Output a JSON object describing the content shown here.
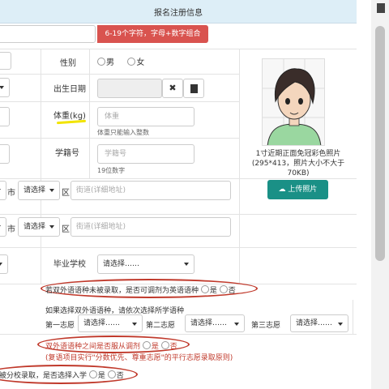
{
  "header": {
    "title": "报名注册信息"
  },
  "username_hint": "6-19个字符，字母+数字组合",
  "gender": {
    "label": "性别",
    "options": [
      "男",
      "女"
    ]
  },
  "birthdate": {
    "label": "出生日期"
  },
  "weight": {
    "label": "体重(kg)",
    "placeholder": "体重",
    "help": "体重只能输入整数"
  },
  "student_id": {
    "label": "学籍号",
    "placeholder": "学籍号",
    "help": "19位数字"
  },
  "photo": {
    "caption": "1寸近期正面免冠彩色照片(295*413，照片大小不大于70KB)",
    "upload_label": "上传照片"
  },
  "address1": {
    "city_suffix": "市",
    "district_select": "请选择",
    "district_suffix": "区",
    "street_placeholder": "街道(详细地址)"
  },
  "address2": {
    "city_suffix": "市",
    "district_select": "请选择",
    "district_suffix": "区",
    "street_placeholder": "街道(详细地址)"
  },
  "graduation_school": {
    "label": "毕业学校",
    "select": "请选择……"
  },
  "language_adjust": {
    "text": "若双外语语种未被录取，是否可调剂为英语语种",
    "yes": "是",
    "no": "否"
  },
  "language_choice": {
    "intro": "如果选择双外语语种，请依次选择所学语种",
    "choices": [
      {
        "label": "第一志愿",
        "select": "请选择……"
      },
      {
        "label": "第二志愿",
        "select": "请选择……"
      },
      {
        "label": "第三志愿",
        "select": "请选择……"
      }
    ]
  },
  "obey_adjust": {
    "text": "双外语语种之间是否服从调剂",
    "yes": "是",
    "no": "否"
  },
  "parallel_note": "(复语项目实行\"分数优先、尊重志愿\"的平行志愿录取原则)",
  "branch_admit": {
    "text": "若被分校录取，是否选择入学",
    "yes": "是",
    "no": "否"
  }
}
